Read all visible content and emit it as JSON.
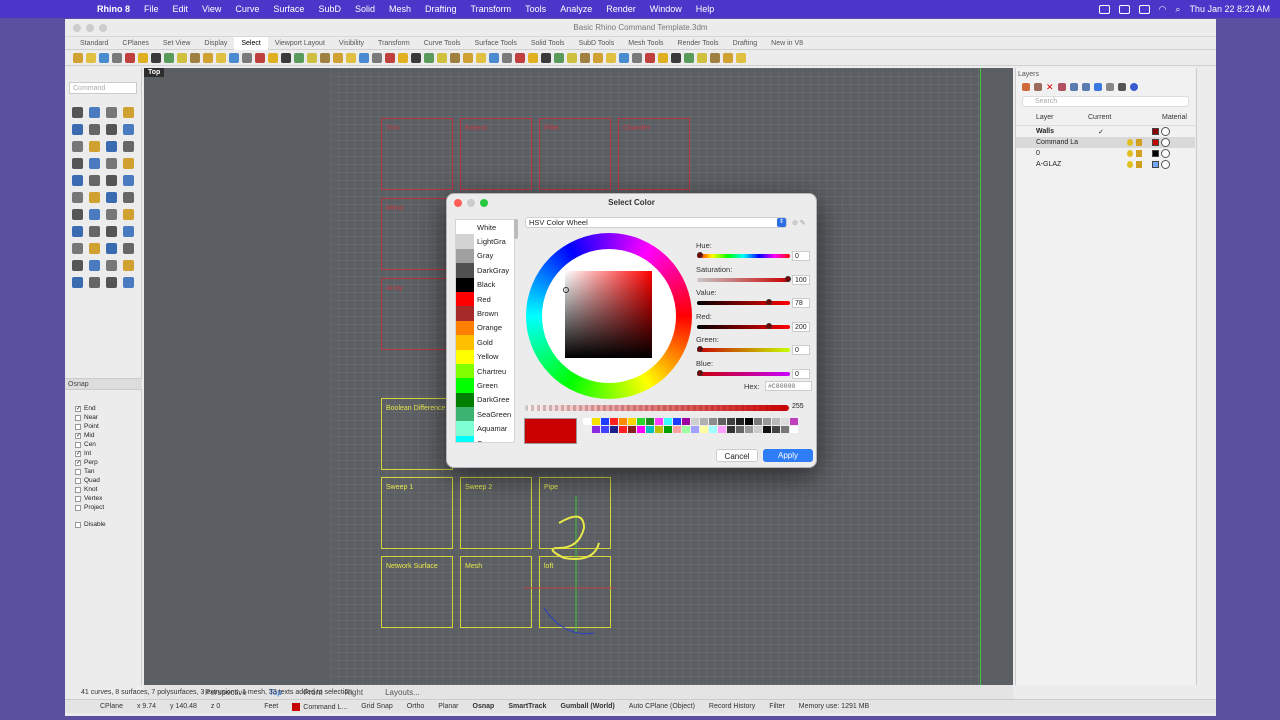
{
  "menubar": {
    "app_name": "Rhino 8",
    "items": [
      "File",
      "Edit",
      "View",
      "Curve",
      "Surface",
      "SubD",
      "Solid",
      "Mesh",
      "Drafting",
      "Transform",
      "Tools",
      "Analyze",
      "Render",
      "Window",
      "Help"
    ],
    "clock": "Thu Jan 22  8:23 AM"
  },
  "window": {
    "title": "Basic Rhino Command Template.3dm"
  },
  "toolbar_tabs": [
    "Standard",
    "CPlanes",
    "Set View",
    "Display",
    "Select",
    "Viewport Layout",
    "Visibility",
    "Transform",
    "Curve Tools",
    "Surface Tools",
    "Solid Tools",
    "SubD Tools",
    "Mesh Tools",
    "Render Tools",
    "Drafting",
    "New in V8"
  ],
  "active_tab": "Select",
  "command": {
    "placeholder": "Command"
  },
  "osnap": {
    "title": "Osnap",
    "items": [
      {
        "label": "End",
        "checked": true
      },
      {
        "label": "Near",
        "checked": false
      },
      {
        "label": "Point",
        "checked": false
      },
      {
        "label": "Mid",
        "checked": true
      },
      {
        "label": "Cen",
        "checked": false
      },
      {
        "label": "Int",
        "checked": true
      },
      {
        "label": "Perp",
        "checked": true
      },
      {
        "label": "Tan",
        "checked": false
      },
      {
        "label": "Quad",
        "checked": false
      },
      {
        "label": "Knot",
        "checked": false
      },
      {
        "label": "Vertex",
        "checked": false
      },
      {
        "label": "Project",
        "checked": false
      }
    ],
    "disable_label": "Disable"
  },
  "viewport": {
    "label": "Top",
    "red_cells": [
      "Trim",
      "Extend",
      "Fillet",
      "Chamfer",
      "Mirror",
      "Array"
    ],
    "yellow_cells": [
      "Boolean Difference",
      "Sweep 1",
      "Sweep 2",
      "Pipe",
      "Network Surface",
      "Mesh",
      "loft"
    ],
    "tabs": [
      "Perspective",
      "Top",
      "Front",
      "Right",
      "Layouts..."
    ],
    "active_tab": "Top"
  },
  "layers": {
    "title": "Layers",
    "search_placeholder": "Search",
    "columns": {
      "layer": "Layer",
      "current": "Current",
      "material": "Material"
    },
    "rows": [
      {
        "name": "Walls",
        "color": "#8b0000",
        "current": "✓"
      },
      {
        "name": "Command La",
        "color": "#c80000",
        "current": ""
      },
      {
        "name": "0",
        "color": "#000000",
        "current": ""
      },
      {
        "name": "A-GLAZ",
        "color": "#6fa8ff",
        "current": ""
      }
    ]
  },
  "status": {
    "message": "41 curves, 8 surfaces, 7 polysurfaces, 3 extrusions, 1 mesh, 33 texts added to selection.",
    "cplane": "CPlane",
    "x": "x 9.74",
    "y": "y 140.48",
    "z": "z 0",
    "units": "Feet",
    "layer": "Command L...",
    "items": [
      "Grid Snap",
      "Ortho",
      "Planar"
    ],
    "osnap": "Osnap",
    "smarttrack": "SmartTrack",
    "gumball": "Gumball (World)",
    "autocplane": "Auto CPlane (Object)",
    "record": "Record History",
    "filter": "Filter",
    "memory": "Memory use: 1291 MB"
  },
  "dialog": {
    "title": "Select Color",
    "mode": "HSV Color Wheel",
    "colors": [
      {
        "name": "White",
        "hex": "#ffffff"
      },
      {
        "name": "LightGra",
        "hex": "#d3d3d3"
      },
      {
        "name": "Gray",
        "hex": "#a0a0a0"
      },
      {
        "name": "DarkGray",
        "hex": "#505050"
      },
      {
        "name": "Black",
        "hex": "#000000"
      },
      {
        "name": "Red",
        "hex": "#ff0000"
      },
      {
        "name": "Brown",
        "hex": "#a52a2a"
      },
      {
        "name": "Orange",
        "hex": "#ff7f00"
      },
      {
        "name": "Gold",
        "hex": "#ffbf00"
      },
      {
        "name": "Yellow",
        "hex": "#ffff00"
      },
      {
        "name": "Chartreu",
        "hex": "#7fff00"
      },
      {
        "name": "Green",
        "hex": "#00ff00"
      },
      {
        "name": "DarkGree",
        "hex": "#007f00"
      },
      {
        "name": "SeaGreen",
        "hex": "#3cb371"
      },
      {
        "name": "Aquamar",
        "hex": "#7fffd4"
      },
      {
        "name": "Cyan",
        "hex": "#00ffff"
      }
    ],
    "sliders": {
      "hue": {
        "label": "Hue:",
        "value": "0",
        "fraction": 0.0
      },
      "saturation": {
        "label": "Saturation:",
        "value": "100",
        "fraction": 1.0
      },
      "val": {
        "label": "Value:",
        "value": "78",
        "fraction": 0.78
      },
      "red": {
        "label": "Red:",
        "value": "200",
        "fraction": 0.78
      },
      "green": {
        "label": "Green:",
        "value": "0",
        "fraction": 0.0
      },
      "blue": {
        "label": "Blue:",
        "value": "0",
        "fraction": 0.0
      }
    },
    "hex_label": "Hex:",
    "hex_value": "#C80000",
    "alpha": "255",
    "selected_color": "#c80000",
    "cancel_label": "Cancel",
    "apply_label": "Apply"
  }
}
